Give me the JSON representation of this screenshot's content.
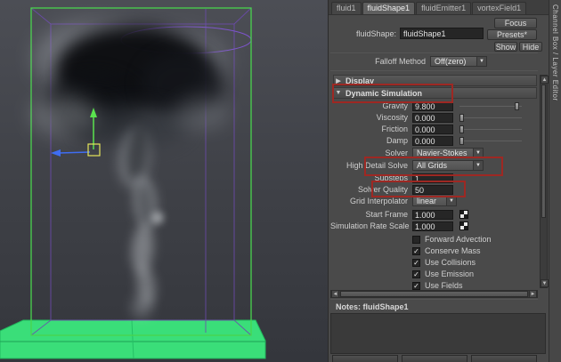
{
  "viewport": {
    "container_color": "#49d44d",
    "curve_color": "#7d54cc",
    "ground_color": "#3ade79",
    "manipulator_colors": {
      "y_axis": "#5ae24e",
      "x_axis": "#3f6df2",
      "center": "#e6e65a"
    }
  },
  "icons": {
    "dropdown_arrow": "▼",
    "section_collapsed": "▶",
    "section_expanded": "▼",
    "scroll_left": "◄",
    "scroll_right": "►",
    "scroll_up": "▲",
    "scroll_down": "▼"
  },
  "ae": {
    "tabs": [
      {
        "label": "fluid1"
      },
      {
        "label": "fluidShape1"
      },
      {
        "label": "fluidEmitter1"
      },
      {
        "label": "vortexField1"
      }
    ],
    "focus_button": "Focus",
    "presets_button": "Presets*",
    "show_button": "Show",
    "hide_button": "Hide",
    "node_type_label": "fluidShape:",
    "node_name": "fluidShape1",
    "falloff": {
      "label": "Falloff Method",
      "value": "Off(zero)"
    },
    "section_display": "Display",
    "section_dynamic": "Dynamic Simulation",
    "sliders": [
      {
        "label": "Gravity",
        "value": "9.800"
      },
      {
        "label": "Viscosity",
        "value": "0.000"
      },
      {
        "label": "Friction",
        "value": "0.000"
      },
      {
        "label": "Damp",
        "value": "0.000"
      }
    ],
    "solver": {
      "label": "Solver",
      "value": "Navier-Stokes"
    },
    "high_detail_solve": {
      "label": "High Detail Solve",
      "value": "All Grids"
    },
    "substeps": {
      "label": "Substeps",
      "value": "1"
    },
    "solver_quality": {
      "label": "Solver Quality",
      "value": "50"
    },
    "grid_interpolator": {
      "label": "Grid Interpolator",
      "value": "linear"
    },
    "start_frame": {
      "label": "Start Frame",
      "value": "1.000"
    },
    "sim_rate_scale": {
      "label": "Simulation Rate Scale",
      "value": "1.000"
    },
    "checkboxes": [
      {
        "label": "Forward Advection",
        "mark": ""
      },
      {
        "label": "Conserve Mass",
        "mark": "✓"
      },
      {
        "label": "Use Collisions",
        "mark": "✓"
      },
      {
        "label": "Use Emission",
        "mark": "✓"
      },
      {
        "label": "Use Fields",
        "mark": "✓"
      }
    ],
    "notes_label": "Notes: fluidShape1"
  },
  "side_strip": {
    "label": "Channel Box / Layer Editor"
  },
  "annotations": {
    "color": "#9e2823"
  }
}
